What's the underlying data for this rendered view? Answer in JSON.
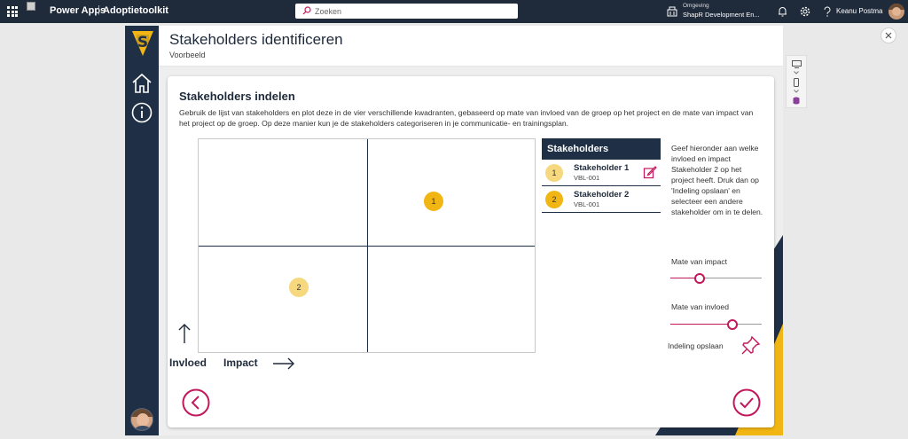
{
  "topbar": {
    "app_name": "Power Apps",
    "separator": "|",
    "app_title": "Adoptietoolkit",
    "search_placeholder": "Zoeken",
    "environment_label": "Omgeving",
    "environment_name": "ShapR Development En...",
    "user_name": "Keanu Postma"
  },
  "header": {
    "title": "Stakeholders identificeren",
    "subtitle": "Voorbeeld"
  },
  "card": {
    "title": "Stakeholders indelen",
    "description": "Gebruik de lijst van stakeholders en plot deze in de vier verschillende kwadranten, gebaseerd op mate van invloed van de groep op het project en de mate van impact van het project op de groep. Op deze manier kun je de stakeholders categoriseren in je communicatie- en trainingsplan."
  },
  "quadrant": {
    "dots": [
      {
        "label": "1"
      },
      {
        "label": "2"
      }
    ],
    "x_axis_label": "Invloed",
    "y_axis_label": "Impact"
  },
  "stakeholders": {
    "heading": "Stakeholders",
    "items": [
      {
        "number": "1",
        "name": "Stakeholder 1",
        "code": "VBL-001"
      },
      {
        "number": "2",
        "name": "Stakeholder 2",
        "code": "VBL-001"
      }
    ]
  },
  "instructions": "Geef hieronder aan welke invloed en impact Stakeholder 2 op het project heeft. Druk dan op 'Indeling opslaan' en selecteer een andere stakeholder om in te delen.",
  "sliders": {
    "impact_label": "Mate van impact",
    "impact_value": 0.3,
    "invloed_label": "Mate van invloed",
    "invloed_value": 0.7
  },
  "save_label": "Indeling opslaan",
  "colors": {
    "navy": "#1f2f45",
    "accent_pink": "#c2185b",
    "gold": "#f1b613",
    "gold_light": "#f6d87f"
  }
}
